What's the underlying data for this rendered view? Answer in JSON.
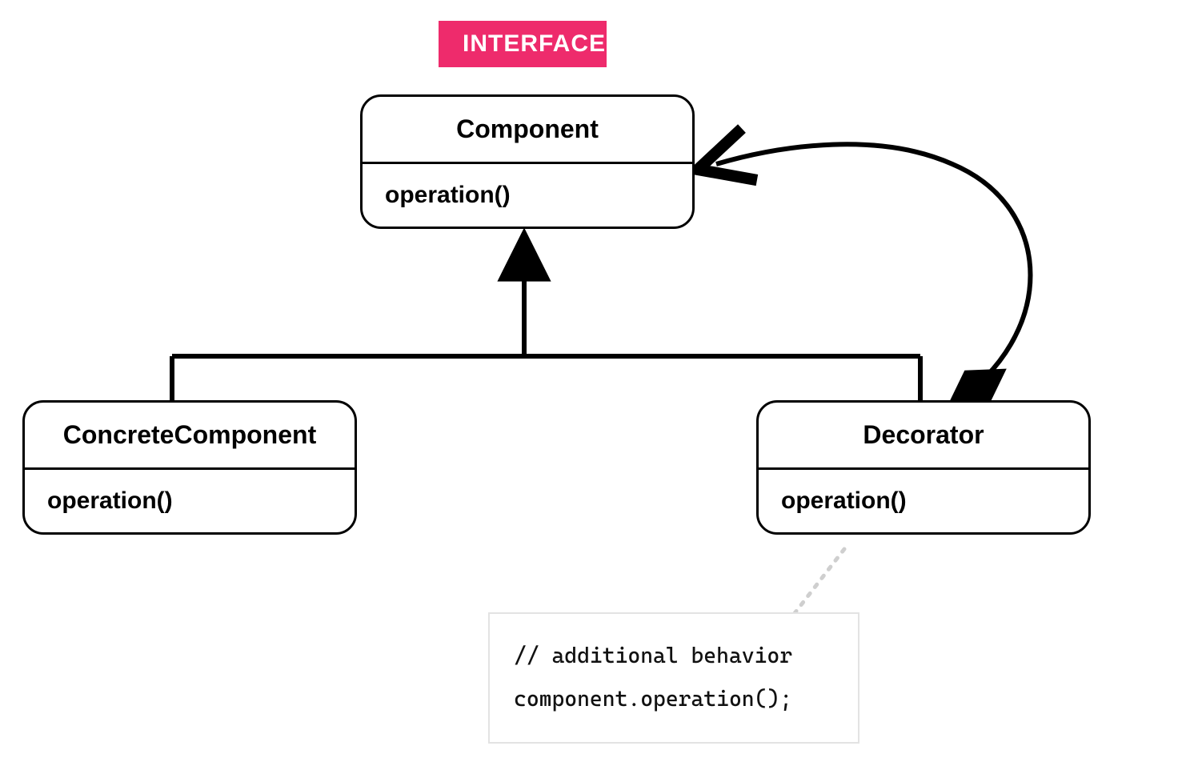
{
  "stereotype": {
    "label": "INTERFACE"
  },
  "classes": {
    "component": {
      "name": "Component",
      "operation": "operation()"
    },
    "concrete": {
      "name": "ConcreteComponent",
      "operation": "operation()"
    },
    "decorator": {
      "name": "Decorator",
      "operation": "operation()"
    }
  },
  "note": {
    "line1": "// additional behavior",
    "line2": "component.operation();"
  },
  "relations": {
    "generalization": "ConcreteComponent and Decorator generalize Component",
    "aggregation": "Decorator has-a Component (diamond on Decorator side, arrow into Component)"
  },
  "colors": {
    "accent": "#ee2b6c",
    "line": "#000000",
    "noteBorder": "#e3e3e3"
  }
}
